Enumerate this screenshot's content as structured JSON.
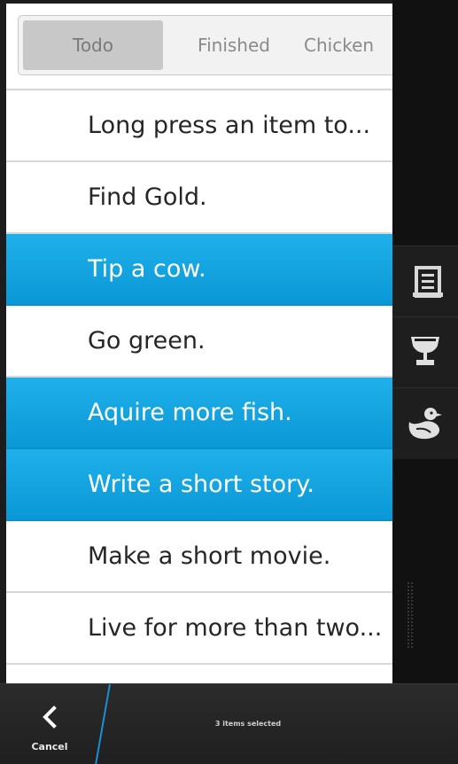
{
  "segmented_control": {
    "tabs": [
      {
        "label": "Todo",
        "selected": true
      },
      {
        "label": "Finished",
        "selected": false
      },
      {
        "label": "Chicken",
        "selected": false
      }
    ]
  },
  "todo_list": {
    "items": [
      {
        "text": "Long press an item to...",
        "selected": false
      },
      {
        "text": "Find Gold.",
        "selected": false
      },
      {
        "text": "Tip a cow.",
        "selected": true
      },
      {
        "text": "Go green.",
        "selected": false
      },
      {
        "text": "Aquire more fish.",
        "selected": true
      },
      {
        "text": "Write a short story.",
        "selected": true
      },
      {
        "text": "Make a short movie.",
        "selected": false
      },
      {
        "text": "Live for more than two...",
        "selected": false
      }
    ]
  },
  "action_strip": {
    "actions": [
      {
        "icon": "list-icon"
      },
      {
        "icon": "trophy-icon"
      },
      {
        "icon": "duck-icon"
      }
    ]
  },
  "bottom_bar": {
    "cancel_label": "Cancel",
    "status_text": "3 items selected"
  },
  "colors": {
    "selection": "#0fa4e0",
    "list_background": "#ffffff",
    "chrome_dark": "#1c1c1c"
  }
}
